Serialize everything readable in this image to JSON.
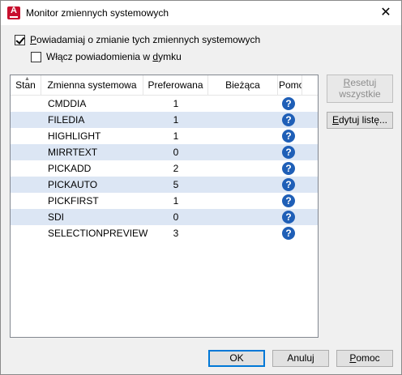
{
  "window": {
    "title": "Monitor zmiennych systemowych",
    "close_glyph": "✕",
    "app_icon": "autocad-icon"
  },
  "options": {
    "notify_label_prefix": "P",
    "notify_label_rest": "owiadamiaj o zmianie tych zmiennych systemowych",
    "notify_checked": true,
    "balloon_label_before": "Włącz powiadomienia w ",
    "balloon_label_u": "d",
    "balloon_label_after": "ymku",
    "balloon_checked": false
  },
  "table": {
    "columns": [
      "Stan",
      "Zmienna systemowa",
      "Preferowana",
      "Bieżąca",
      "Pomoc"
    ],
    "rows": [
      {
        "name": "CMDDIA",
        "preferred": "1",
        "current": ""
      },
      {
        "name": "FILEDIA",
        "preferred": "1",
        "current": ""
      },
      {
        "name": "HIGHLIGHT",
        "preferred": "1",
        "current": ""
      },
      {
        "name": "MIRRTEXT",
        "preferred": "0",
        "current": ""
      },
      {
        "name": "PICKADD",
        "preferred": "2",
        "current": ""
      },
      {
        "name": "PICKAUTO",
        "preferred": "5",
        "current": ""
      },
      {
        "name": "PICKFIRST",
        "preferred": "1",
        "current": ""
      },
      {
        "name": "SDI",
        "preferred": "0",
        "current": ""
      },
      {
        "name": "SELECTIONPREVIEW",
        "preferred": "3",
        "current": ""
      }
    ],
    "help_glyph": "?"
  },
  "buttons": {
    "reset_line1_u": "R",
    "reset_line1_rest": "esetuj",
    "reset_line2": "wszystkie",
    "edit_before": "",
    "edit_u": "E",
    "edit_after": "dytuj listę...",
    "ok": "OK",
    "cancel": "Anuluj",
    "help_u": "P",
    "help_rest": "omoc"
  }
}
